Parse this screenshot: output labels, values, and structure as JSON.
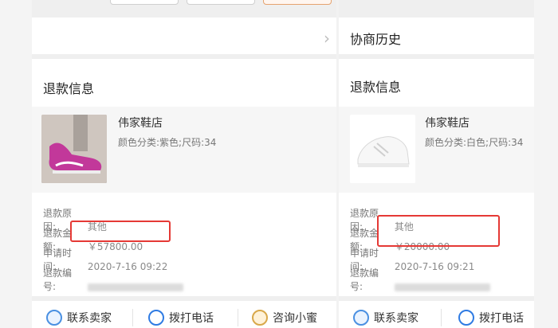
{
  "left": {
    "section_title": "退款信息",
    "product": {
      "store": "伟家鞋店",
      "sku": "颜色分类:紫色;尺码:34"
    },
    "details": {
      "reason_label": "退款原因:",
      "reason_value": "其他",
      "amount_label": "退款金额:",
      "amount_value": "￥57800.00",
      "time_label": "申请时间:",
      "time_value": "2020-7-16 09:22",
      "id_label": "退款编号:"
    },
    "actions": {
      "contact_seller": "联系卖家",
      "call_phone": "拨打电话",
      "ask_assistant": "咨询小蜜"
    }
  },
  "right": {
    "history_title": "协商历史",
    "section_title": "退款信息",
    "product": {
      "store": "伟家鞋店",
      "sku": "颜色分类:白色;尺码:34"
    },
    "details": {
      "reason_label": "退款原因:",
      "reason_value": "其他",
      "amount_label": "退款金额:",
      "amount_value": "￥20000.00",
      "time_label": "申请时间:",
      "time_value": "2020-7-16 09:21",
      "id_label": "退款编号:"
    },
    "actions": {
      "contact_seller": "联系卖家",
      "call_phone": "拨打电话"
    }
  },
  "colors": {
    "highlight": "#e53935",
    "accent": "#4a90e2"
  }
}
